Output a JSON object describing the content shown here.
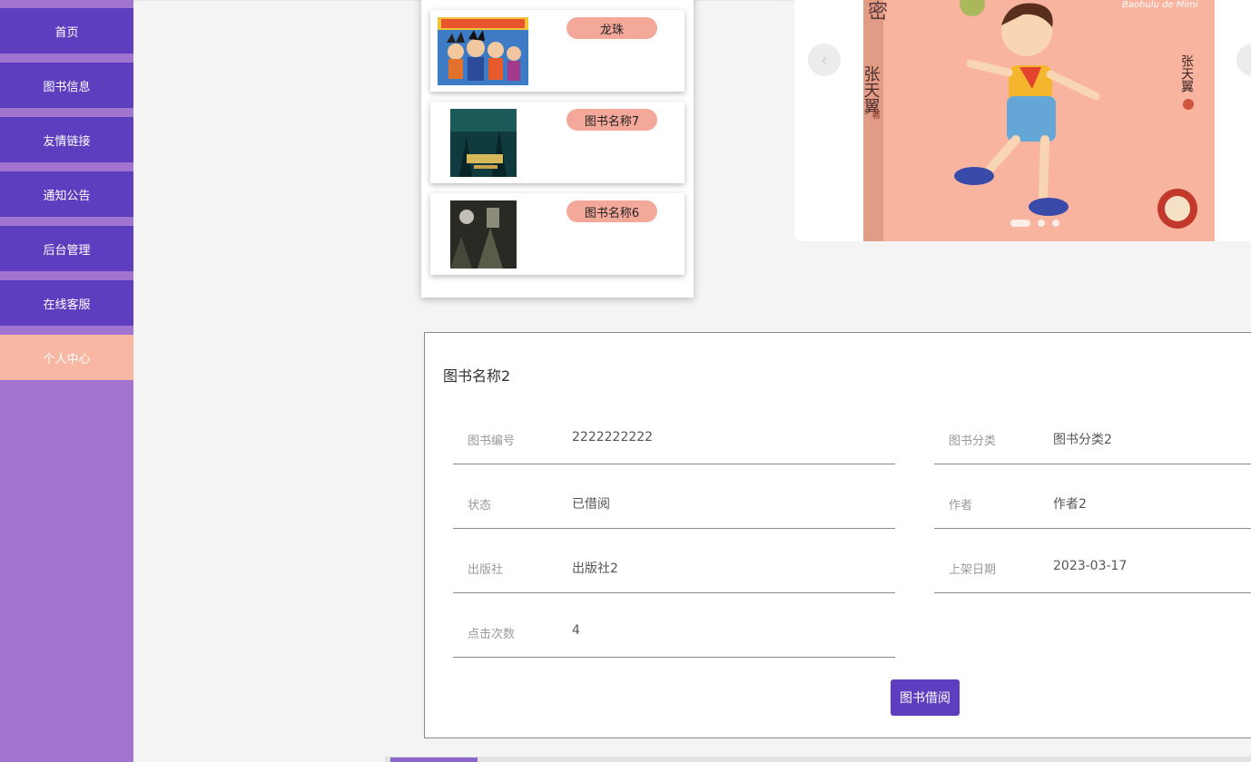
{
  "sidebar": {
    "items": [
      {
        "label": "首页"
      },
      {
        "label": "图书信息"
      },
      {
        "label": "友情链接"
      },
      {
        "label": "通知公告"
      },
      {
        "label": "后台管理"
      },
      {
        "label": "在线客服"
      },
      {
        "label": "个人中心"
      }
    ],
    "active_index": 6
  },
  "book_list": [
    {
      "tag": "龙珠"
    },
    {
      "tag": "图书名称7"
    },
    {
      "tag": "图书名称6"
    }
  ],
  "carousel": {
    "prev_icon": "chevron-left-icon",
    "next_icon": "chevron-right-icon",
    "cover": {
      "author": "张天翼",
      "author_mark": "著",
      "subtitle": "Baohulu de Mimi",
      "title_char": "密"
    }
  },
  "detail": {
    "title": "图书名称2",
    "fields": [
      {
        "label": "图书编号",
        "value": "2222222222"
      },
      {
        "label": "图书分类",
        "value": "图书分类2"
      },
      {
        "label": "状态",
        "value": "已借阅"
      },
      {
        "label": "作者",
        "value": "作者2"
      },
      {
        "label": "出版社",
        "value": "出版社2"
      },
      {
        "label": "上架日期",
        "value": "2023-03-17"
      },
      {
        "label": "点击次数",
        "value": "4"
      }
    ],
    "borrow_button": "图书借阅"
  },
  "colors": {
    "nav_bg": "#5d3ebf",
    "nav_active_bg": "#f8b7a3",
    "sidebar_bg": "#a074cf",
    "tag_bg": "#f4a89a",
    "button_bg": "#5d3ebf"
  }
}
